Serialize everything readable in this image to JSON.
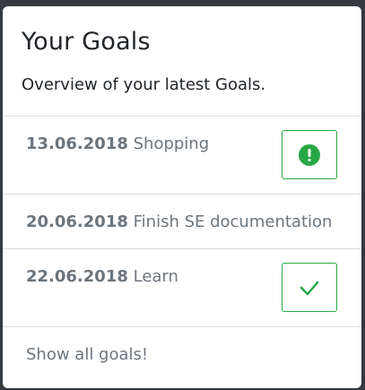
{
  "card": {
    "title": "Your Goals",
    "subtitle": "Overview of your latest Goals."
  },
  "goals": [
    {
      "date": "13.06.2018",
      "name": "Shopping",
      "status_icon": "exclamation-circle-icon",
      "status_color": "#28a745"
    },
    {
      "date": "20.06.2018",
      "name": "Finish SE documentation"
    },
    {
      "date": "22.06.2018",
      "name": "Learn",
      "status_icon": "checkmark-icon",
      "status_color": "#28a745"
    }
  ],
  "footer": {
    "link_label": "Show all goals!"
  },
  "colors": {
    "accent": "#28a745",
    "background": "#343a40"
  }
}
